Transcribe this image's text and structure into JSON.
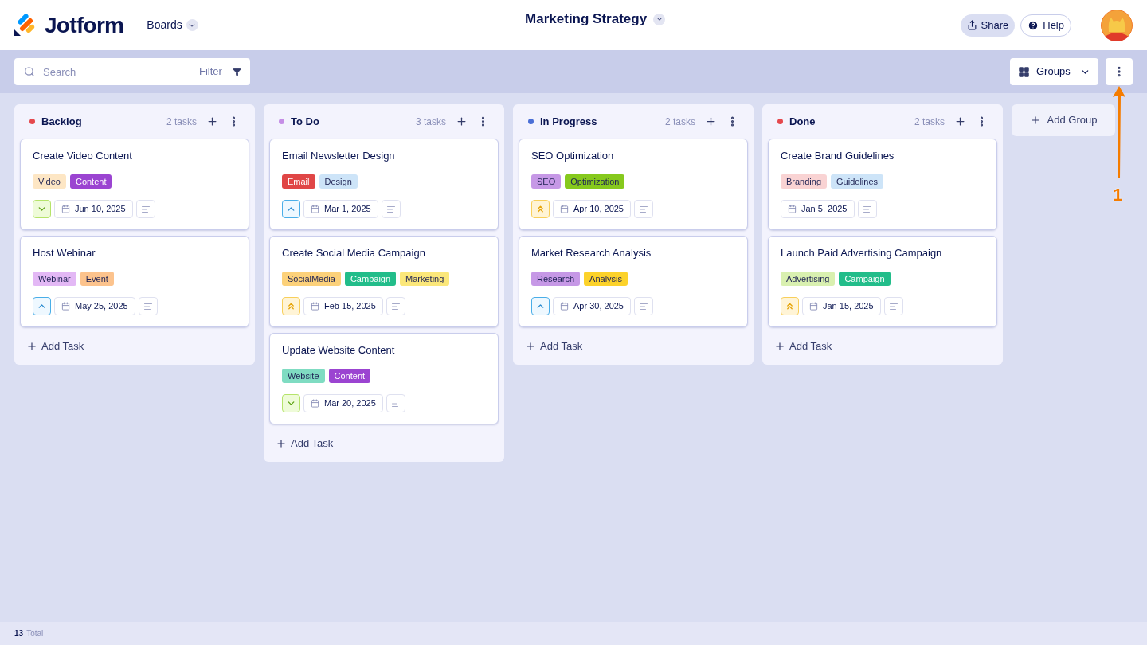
{
  "header": {
    "logo_text": "Jotform",
    "section": "Boards",
    "board_title": "Marketing Strategy",
    "share": "Share",
    "help": "Help"
  },
  "toolbar": {
    "search": {
      "placeholder": "Search"
    },
    "filter": "Filter",
    "groups": "Groups"
  },
  "annotation": {
    "label": "1"
  },
  "groups": [
    {
      "name": "Backlog",
      "color": "#e5484d",
      "count": "2 tasks",
      "add_task": "Add Task",
      "tasks": [
        {
          "title": "Create Video Content",
          "tags": [
            {
              "label": "Video",
              "color": "#fde6c4"
            },
            {
              "label": "Content",
              "color": "#9b44d1"
            }
          ],
          "priority": {
            "kind": "low"
          },
          "date": "Jun 10, 2025"
        },
        {
          "title": "Host Webinar",
          "tags": [
            {
              "label": "Webinar",
              "color": "#e3b8f5"
            },
            {
              "label": "Event",
              "color": "#fcc38d"
            }
          ],
          "priority": {
            "kind": "medium"
          },
          "date": "May 25, 2025"
        }
      ]
    },
    {
      "name": "To Do",
      "color": "#c58ee6",
      "count": "3 tasks",
      "add_task": "Add Task",
      "tasks": [
        {
          "title": "Email Newsletter Design",
          "tags": [
            {
              "label": "Email",
              "color": "#e04646"
            },
            {
              "label": "Design",
              "color": "#cde4f8"
            }
          ],
          "priority": {
            "kind": "medium"
          },
          "date": "Mar 1, 2025"
        },
        {
          "title": "Create Social Media Campaign",
          "tags": [
            {
              "label": "SocialMedia",
              "color": "#fcd17a"
            },
            {
              "label": "Campaign",
              "color": "#22bd8a"
            },
            {
              "label": "Marketing",
              "color": "#fbe77a"
            }
          ],
          "priority": {
            "kind": "high"
          },
          "date": "Feb 15, 2025"
        },
        {
          "title": "Update Website Content",
          "tags": [
            {
              "label": "Website",
              "color": "#7fdcc2"
            },
            {
              "label": "Content",
              "color": "#9b44d1"
            }
          ],
          "priority": {
            "kind": "low"
          },
          "date": "Mar 20, 2025"
        }
      ]
    },
    {
      "name": "In Progress",
      "color": "#4a6fd6",
      "count": "2 tasks",
      "add_task": "Add Task",
      "tasks": [
        {
          "title": "SEO Optimization",
          "tags": [
            {
              "label": "SEO",
              "color": "#c698e6"
            },
            {
              "label": "Optimization",
              "color": "#86c91d"
            }
          ],
          "priority": {
            "kind": "high"
          },
          "date": "Apr 10, 2025"
        },
        {
          "title": "Market Research Analysis",
          "tags": [
            {
              "label": "Research",
              "color": "#c698e6"
            },
            {
              "label": "Analysis",
              "color": "#fcd22a"
            }
          ],
          "priority": {
            "kind": "medium"
          },
          "date": "Apr 30, 2025"
        }
      ]
    },
    {
      "name": "Done",
      "color": "#e5484d",
      "count": "2 tasks",
      "add_task": "Add Task",
      "tasks": [
        {
          "title": "Create Brand Guidelines",
          "tags": [
            {
              "label": "Branding",
              "color": "#f9d3d3"
            },
            {
              "label": "Guidelines",
              "color": "#cde4f8"
            }
          ],
          "date": "Jan 5, 2025"
        },
        {
          "title": "Launch Paid Advertising Campaign",
          "tags": [
            {
              "label": "Advertising",
              "color": "#d9f0b0"
            },
            {
              "label": "Campaign",
              "color": "#22bd8a"
            }
          ],
          "priority": {
            "kind": "high"
          },
          "date": "Jan 15, 2025"
        }
      ]
    }
  ],
  "add_group": "Add Group",
  "footer": {
    "count": "13",
    "label": "Total"
  }
}
